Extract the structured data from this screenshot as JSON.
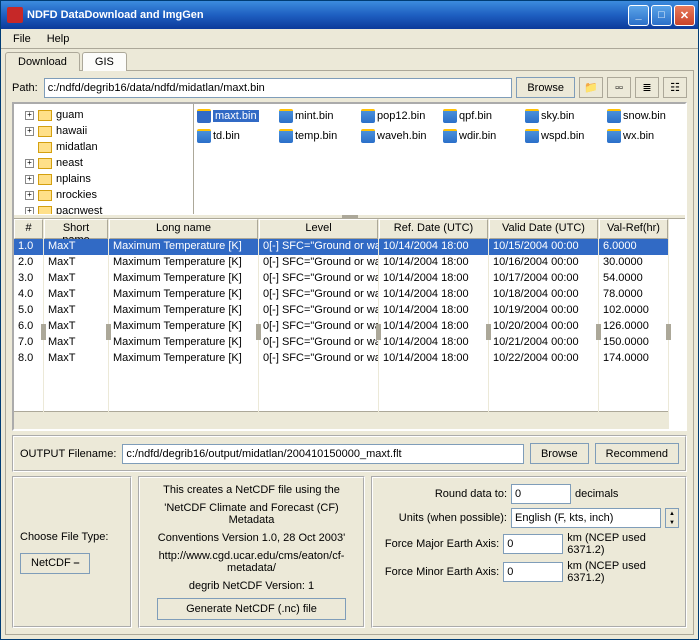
{
  "window": {
    "title": "NDFD DataDownload and ImgGen"
  },
  "menu": {
    "file": "File",
    "help": "Help"
  },
  "maintabs": {
    "download": "Download",
    "gis": "GIS"
  },
  "path": {
    "label": "Path:",
    "value": "c:/ndfd/degrib16/data/ndfd/midatlan/maxt.bin",
    "browse": "Browse"
  },
  "tree": {
    "items": [
      {
        "label": "guam",
        "box": "+"
      },
      {
        "label": "hawaii",
        "box": "+"
      },
      {
        "label": "midatlan",
        "box": ""
      },
      {
        "label": "neast",
        "box": "+"
      },
      {
        "label": "nplains",
        "box": "+"
      },
      {
        "label": "nrockies",
        "box": "+"
      },
      {
        "label": "pacnwest",
        "box": "+"
      }
    ]
  },
  "files": [
    {
      "name": "maxt.bin",
      "selected": true
    },
    {
      "name": "mint.bin"
    },
    {
      "name": "pop12.bin"
    },
    {
      "name": "qpf.bin"
    },
    {
      "name": "sky.bin"
    },
    {
      "name": "snow.bin"
    },
    {
      "name": "td.bin"
    },
    {
      "name": "temp.bin"
    },
    {
      "name": "waveh.bin"
    },
    {
      "name": "wdir.bin"
    },
    {
      "name": "wspd.bin"
    },
    {
      "name": "wx.bin"
    }
  ],
  "grid": {
    "headers": {
      "num": "#",
      "short": "Short name",
      "long": "Long name",
      "level": "Level",
      "ref": "Ref. Date (UTC)",
      "valid": "Valid Date (UTC)",
      "valref": "Val-Ref(hr)"
    },
    "rows": [
      {
        "num": "1.0",
        "short": "MaxT",
        "long": "Maximum Temperature [K]",
        "level": "0[-] SFC=\"Ground or wa",
        "ref": "10/14/2004 18:00",
        "valid": "10/15/2004 00:00",
        "valref": "6.0000",
        "sel": true
      },
      {
        "num": "2.0",
        "short": "MaxT",
        "long": "Maximum Temperature [K]",
        "level": "0[-] SFC=\"Ground or wa",
        "ref": "10/14/2004 18:00",
        "valid": "10/16/2004 00:00",
        "valref": "30.0000"
      },
      {
        "num": "3.0",
        "short": "MaxT",
        "long": "Maximum Temperature [K]",
        "level": "0[-] SFC=\"Ground or wa",
        "ref": "10/14/2004 18:00",
        "valid": "10/17/2004 00:00",
        "valref": "54.0000"
      },
      {
        "num": "4.0",
        "short": "MaxT",
        "long": "Maximum Temperature [K]",
        "level": "0[-] SFC=\"Ground or wa",
        "ref": "10/14/2004 18:00",
        "valid": "10/18/2004 00:00",
        "valref": "78.0000"
      },
      {
        "num": "5.0",
        "short": "MaxT",
        "long": "Maximum Temperature [K]",
        "level": "0[-] SFC=\"Ground or wa",
        "ref": "10/14/2004 18:00",
        "valid": "10/19/2004 00:00",
        "valref": "102.0000"
      },
      {
        "num": "6.0",
        "short": "MaxT",
        "long": "Maximum Temperature [K]",
        "level": "0[-] SFC=\"Ground or wa",
        "ref": "10/14/2004 18:00",
        "valid": "10/20/2004 00:00",
        "valref": "126.0000"
      },
      {
        "num": "7.0",
        "short": "MaxT",
        "long": "Maximum Temperature [K]",
        "level": "0[-] SFC=\"Ground or wa",
        "ref": "10/14/2004 18:00",
        "valid": "10/21/2004 00:00",
        "valref": "150.0000"
      },
      {
        "num": "8.0",
        "short": "MaxT",
        "long": "Maximum Temperature [K]",
        "level": "0[-] SFC=\"Ground or wa",
        "ref": "10/14/2004 18:00",
        "valid": "10/22/2004 00:00",
        "valref": "174.0000"
      }
    ]
  },
  "output": {
    "label": "OUTPUT Filename:",
    "value": "c:/ndfd/degrib16/output/midatlan/200410150000_maxt.flt",
    "browse": "Browse",
    "recommend": "Recommend"
  },
  "filetype": {
    "label": "Choose File Type:",
    "button": "NetCDF"
  },
  "desc": {
    "line1": "This creates a NetCDF file using the",
    "line2": "'NetCDF Climate and Forecast (CF) Metadata",
    "line3": "Conventions Version 1.0, 28 Oct 2003'",
    "line4": "http://www.cgd.ucar.edu/cms/eaton/cf-metadata/",
    "line5": "degrib NetCDF Version:  1",
    "button": "Generate NetCDF (.nc) file"
  },
  "opts": {
    "round_label": "Round data to:",
    "round_val": "0",
    "round_unit": "decimals",
    "units_label": "Units (when possible):",
    "units_val": "English (F, kts, inch)",
    "major_label": "Force Major Earth Axis:",
    "major_val": "0",
    "major_unit": "km (NCEP used 6371.2)",
    "minor_label": "Force Minor Earth Axis:",
    "minor_val": "0",
    "minor_unit": "km (NCEP used 6371.2)"
  }
}
